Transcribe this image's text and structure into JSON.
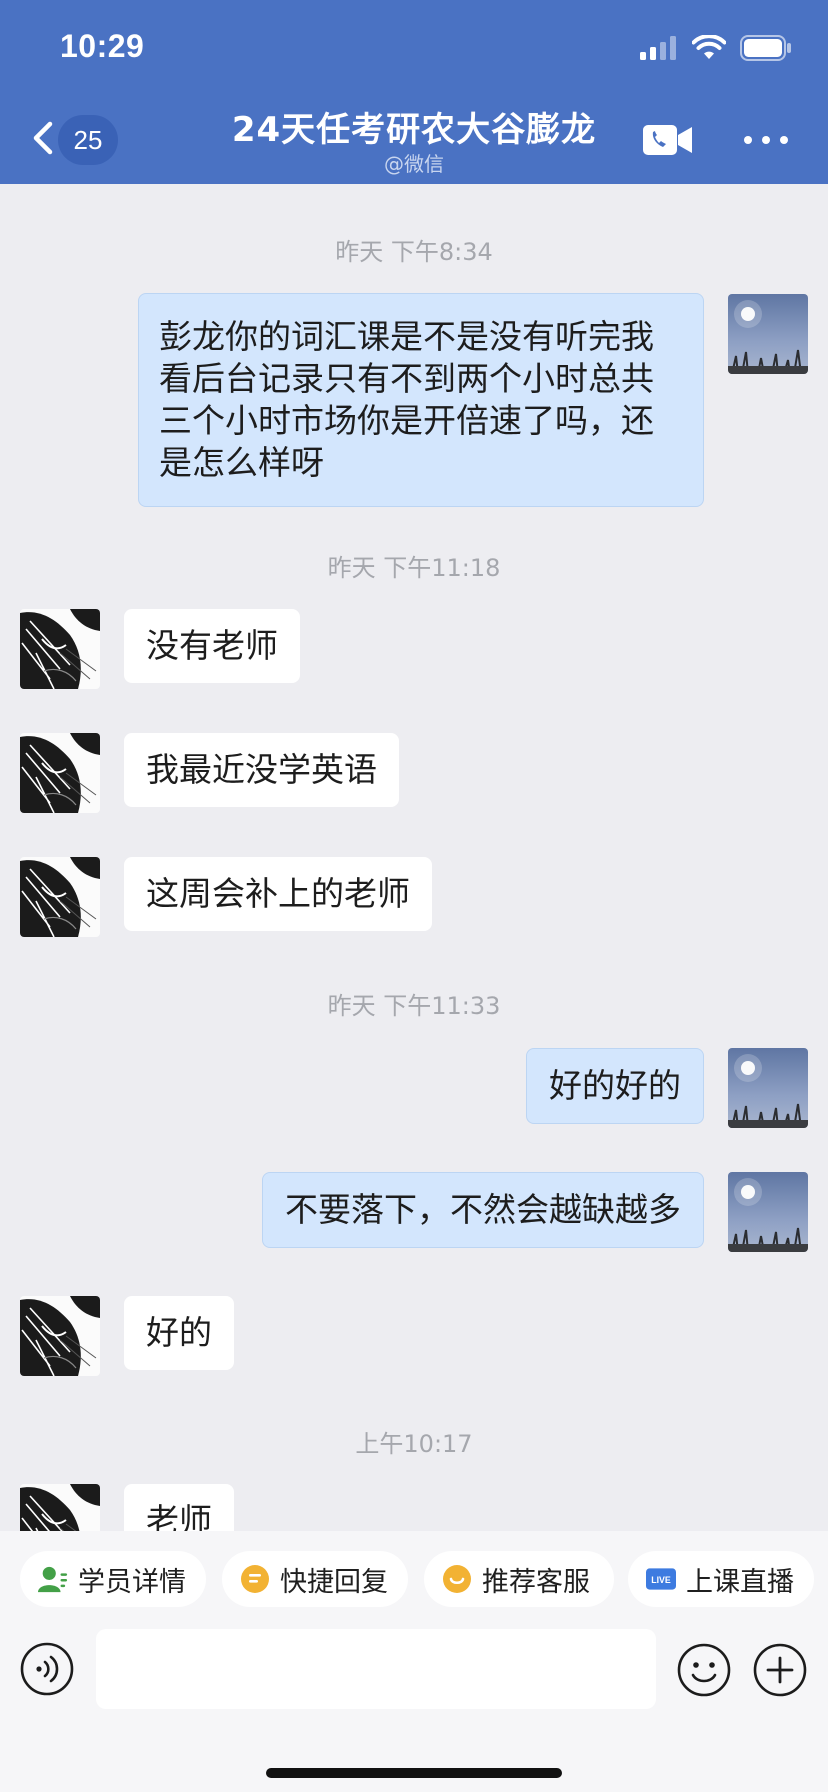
{
  "status_bar": {
    "time": "10:29"
  },
  "header": {
    "unread_count": "25",
    "title": "24天任考研农大谷膨龙",
    "subtitle": "@微信"
  },
  "messages": [
    {
      "kind": "timestamp",
      "text": "昨天 下午8:34"
    },
    {
      "kind": "outgoing",
      "text": "彭龙你的词汇课是不是没有听完我看后台记录只有不到两个小时总共三个小时市场你是开倍速了吗，还是怎么样呀"
    },
    {
      "kind": "timestamp",
      "text": "昨天 下午11:18"
    },
    {
      "kind": "incoming",
      "text": "没有老师"
    },
    {
      "kind": "incoming",
      "text": "我最近没学英语"
    },
    {
      "kind": "incoming",
      "text": "这周会补上的老师"
    },
    {
      "kind": "timestamp",
      "text": "昨天 下午11:33"
    },
    {
      "kind": "outgoing",
      "text": "好的好的"
    },
    {
      "kind": "outgoing",
      "text": "不要落下，不然会越缺越多"
    },
    {
      "kind": "incoming",
      "text": "好的"
    },
    {
      "kind": "timestamp",
      "text": "上午10:17"
    },
    {
      "kind": "incoming",
      "text": "老师"
    }
  ],
  "quick_actions": [
    {
      "label": "学员详情",
      "icon": "user-detail-icon",
      "color": "#43a047"
    },
    {
      "label": "快捷回复",
      "icon": "quick-reply-icon",
      "color": "#f2b233"
    },
    {
      "label": "推荐客服",
      "icon": "service-icon",
      "color": "#f2b233"
    },
    {
      "label": "上课直播",
      "icon": "live-icon",
      "color": "#3d7be0"
    }
  ],
  "input": {
    "placeholder": "",
    "value": ""
  },
  "colors": {
    "header": "#4a72c3",
    "outgoing_bubble": "#d3e6fd",
    "incoming_bubble": "#ffffff",
    "background": "#ededf1"
  }
}
